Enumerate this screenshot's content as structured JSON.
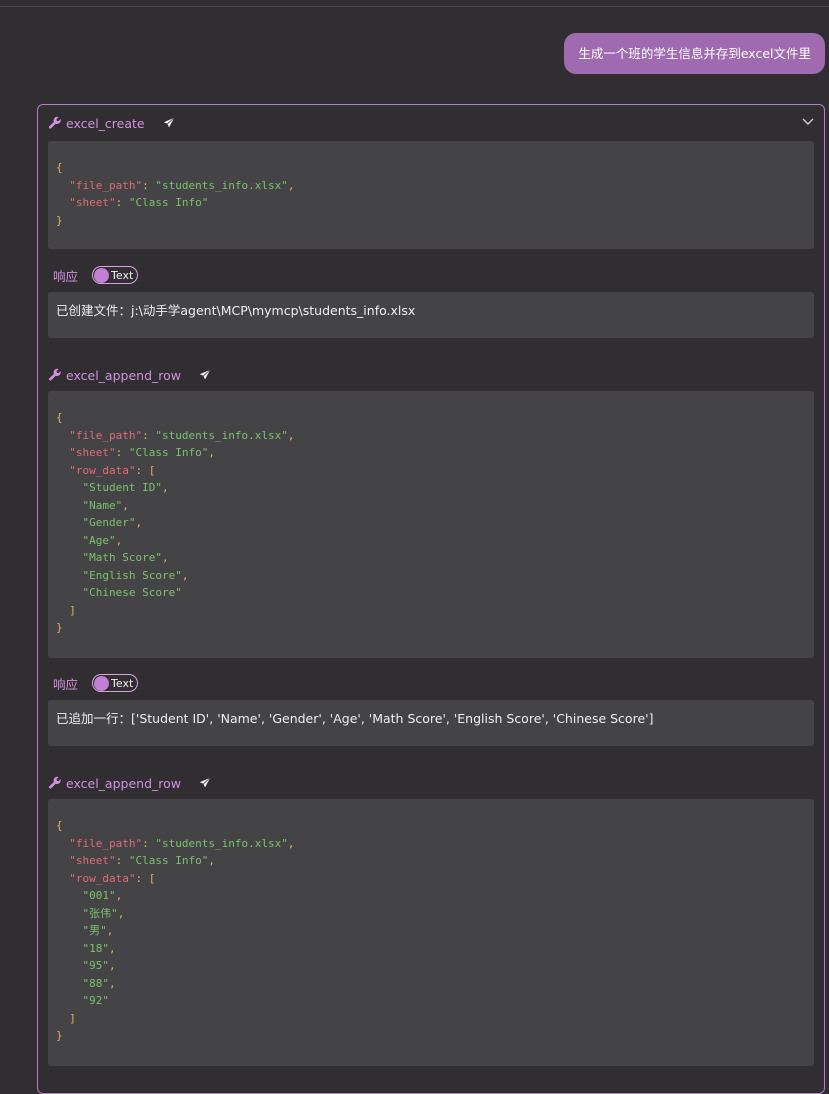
{
  "user_message": "生成一个班的学生信息并存到excel文件里",
  "response_label": "响应",
  "toggle_label": "Text",
  "calls": [
    {
      "tool": "excel_create",
      "code": [
        [
          [
            "p",
            "{"
          ]
        ],
        [
          [
            "p",
            "  "
          ],
          [
            "k",
            "\"file_path\""
          ],
          [
            "p",
            ": "
          ],
          [
            "s",
            "\"students_info.xlsx\""
          ],
          [
            "p",
            ","
          ]
        ],
        [
          [
            "p",
            "  "
          ],
          [
            "k",
            "\"sheet\""
          ],
          [
            "p",
            ": "
          ],
          [
            "s",
            "\"Class Info\""
          ]
        ],
        [
          [
            "p",
            "}"
          ]
        ]
      ],
      "response": "已创建文件：j:\\动手学agent\\MCP\\mymcp\\students_info.xlsx"
    },
    {
      "tool": "excel_append_row",
      "code": [
        [
          [
            "p",
            "{"
          ]
        ],
        [
          [
            "p",
            "  "
          ],
          [
            "k",
            "\"file_path\""
          ],
          [
            "p",
            ": "
          ],
          [
            "s",
            "\"students_info.xlsx\""
          ],
          [
            "p",
            ","
          ]
        ],
        [
          [
            "p",
            "  "
          ],
          [
            "k",
            "\"sheet\""
          ],
          [
            "p",
            ": "
          ],
          [
            "s",
            "\"Class Info\""
          ],
          [
            "p",
            ","
          ]
        ],
        [
          [
            "p",
            "  "
          ],
          [
            "k",
            "\"row_data\""
          ],
          [
            "p",
            ": ["
          ]
        ],
        [
          [
            "p",
            "    "
          ],
          [
            "s",
            "\"Student ID\""
          ],
          [
            "p",
            ","
          ]
        ],
        [
          [
            "p",
            "    "
          ],
          [
            "s",
            "\"Name\""
          ],
          [
            "p",
            ","
          ]
        ],
        [
          [
            "p",
            "    "
          ],
          [
            "s",
            "\"Gender\""
          ],
          [
            "p",
            ","
          ]
        ],
        [
          [
            "p",
            "    "
          ],
          [
            "s",
            "\"Age\""
          ],
          [
            "p",
            ","
          ]
        ],
        [
          [
            "p",
            "    "
          ],
          [
            "s",
            "\"Math Score\""
          ],
          [
            "p",
            ","
          ]
        ],
        [
          [
            "p",
            "    "
          ],
          [
            "s",
            "\"English Score\""
          ],
          [
            "p",
            ","
          ]
        ],
        [
          [
            "p",
            "    "
          ],
          [
            "s",
            "\"Chinese Score\""
          ]
        ],
        [
          [
            "p",
            "  ]"
          ]
        ],
        [
          [
            "p",
            "}"
          ]
        ]
      ],
      "response": "已追加一行：['Student ID', 'Name', 'Gender', 'Age', 'Math Score', 'English Score', 'Chinese Score']"
    },
    {
      "tool": "excel_append_row",
      "code": [
        [
          [
            "p",
            "{"
          ]
        ],
        [
          [
            "p",
            "  "
          ],
          [
            "k",
            "\"file_path\""
          ],
          [
            "p",
            ": "
          ],
          [
            "s",
            "\"students_info.xlsx\""
          ],
          [
            "p",
            ","
          ]
        ],
        [
          [
            "p",
            "  "
          ],
          [
            "k",
            "\"sheet\""
          ],
          [
            "p",
            ": "
          ],
          [
            "s",
            "\"Class Info\""
          ],
          [
            "p",
            ","
          ]
        ],
        [
          [
            "p",
            "  "
          ],
          [
            "k",
            "\"row_data\""
          ],
          [
            "p",
            ": ["
          ]
        ],
        [
          [
            "p",
            "    "
          ],
          [
            "s",
            "\"001\""
          ],
          [
            "p",
            ","
          ]
        ],
        [
          [
            "p",
            "    "
          ],
          [
            "s",
            "\"张伟\""
          ],
          [
            "p",
            ","
          ]
        ],
        [
          [
            "p",
            "    "
          ],
          [
            "s",
            "\"男\""
          ],
          [
            "p",
            ","
          ]
        ],
        [
          [
            "p",
            "    "
          ],
          [
            "s",
            "\"18\""
          ],
          [
            "p",
            ","
          ]
        ],
        [
          [
            "p",
            "    "
          ],
          [
            "s",
            "\"95\""
          ],
          [
            "p",
            ","
          ]
        ],
        [
          [
            "p",
            "    "
          ],
          [
            "s",
            "\"88\""
          ],
          [
            "p",
            ","
          ]
        ],
        [
          [
            "p",
            "    "
          ],
          [
            "s",
            "\"92\""
          ]
        ],
        [
          [
            "p",
            "  ]"
          ]
        ],
        [
          [
            "p",
            "}"
          ]
        ]
      ]
    }
  ]
}
